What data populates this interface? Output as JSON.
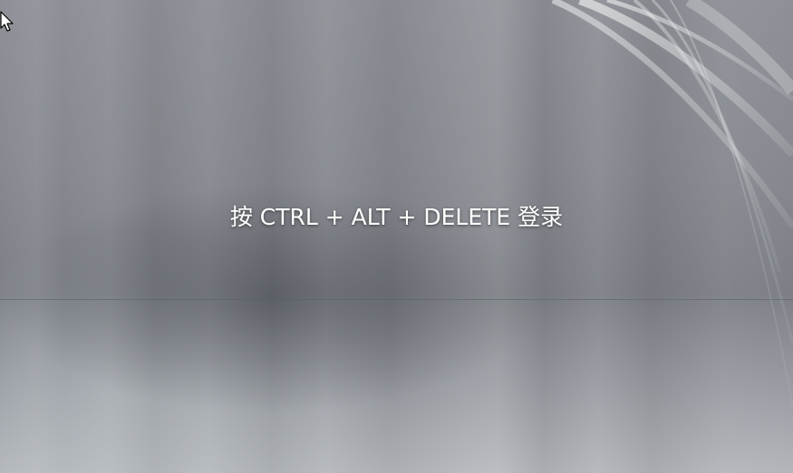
{
  "login_screen": {
    "prompt": "按 CTRL + ALT + DELETE 登录"
  },
  "icons": {
    "cursor": "mouse-pointer-icon"
  },
  "colors": {
    "background": "#868a90",
    "text": "#ffffff"
  }
}
